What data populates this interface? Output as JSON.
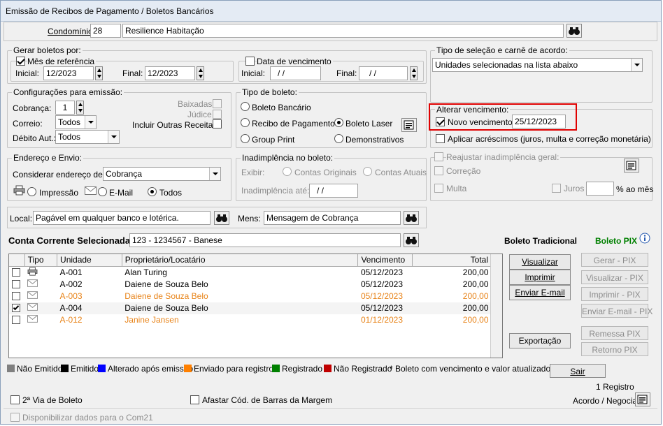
{
  "window": {
    "title": "Emissão de Recibos de Pagamento / Boletos Bancários"
  },
  "condominio": {
    "label": "Condomínio:",
    "code": "28",
    "name": "Resilience Habitação"
  },
  "gerar": {
    "legend": "Gerar boletos por:",
    "mes_label": "Mês de referência",
    "mes_checked": true,
    "inicial_label": "Inicial:",
    "inicial": "12/2023",
    "final_label": "Final:",
    "final": "12/2023",
    "data_label": "Data de vencimento",
    "data_checked": false,
    "d_inicial": "/ /",
    "d_final": "/ /"
  },
  "tipo_selecao": {
    "legend": "Tipo de seleção e carnê de acordo:",
    "value": "Unidades selecionadas na lista abaixo"
  },
  "config": {
    "legend": "Configurações para emissão:",
    "cobranca_label": "Cobrança:",
    "cobranca": "1",
    "correio_label": "Correio:",
    "correio": "Todos",
    "debito_label": "Débito Aut.:",
    "debito": "Todos",
    "baixadas": "Baixadas",
    "judice": "Júdice",
    "outras": "Incluir Outras Receitas"
  },
  "tipo_boleto": {
    "legend": "Tipo de boleto:",
    "opt1": "Boleto Bancário",
    "opt2": "Recibo de Pagamento",
    "opt3": "Boleto Laser",
    "opt4": "Group Print",
    "opt5": "Demonstrativos",
    "selected": "Boleto Laser"
  },
  "alterar": {
    "legend": "Alterar vencimento:",
    "novo_label": "Novo vencimento",
    "novo_checked": true,
    "novo_date": "25/12/2023",
    "acrescimos": "Aplicar acréscimos (juros, multa e correção monetária)"
  },
  "endereco": {
    "legend": "Endereço e Envio:",
    "considerar": "Considerar endereço de:",
    "value": "Cobrança",
    "impressao": "Impressão",
    "email": "E-Mail",
    "todos": "Todos"
  },
  "inad": {
    "legend": "Inadimplência no boleto:",
    "exibir": "Exibir:",
    "originais": "Contas Originais",
    "atuais": "Contas Atuais",
    "ate": "Inadimplência até:",
    "ate_value": "/ /"
  },
  "reajustar": {
    "legend": "Reajustar inadimplência geral:",
    "correcao": "Correção",
    "multa": "Multa",
    "juros": "Juros",
    "ao_mes": "% ao mês"
  },
  "local": {
    "label": "Local:",
    "value": "Pagável em qualquer banco e lotérica.",
    "mens_label": "Mens:",
    "mens_value": "Mensagem de Cobrança"
  },
  "conta": {
    "label": "Conta Corrente Selecionada:",
    "value": "123 - 1234567 - Banese"
  },
  "boleto_trad": "Boleto Tradicional",
  "boleto_pix": "Boleto PIX",
  "table": {
    "headers": [
      "Tipo",
      "Unidade",
      "Proprietário/Locatário",
      "Vencimento",
      "Total"
    ],
    "rows": [
      {
        "checked": false,
        "icon": "printer-icon",
        "unidade": "A-001",
        "nome": "Alan Turing",
        "venc": "05/12/2023",
        "total": "200,00",
        "color": "#000000"
      },
      {
        "checked": false,
        "icon": "envelope-icon",
        "unidade": "A-002",
        "nome": "Daiene de Souza Belo",
        "venc": "05/12/2023",
        "total": "200,00",
        "color": "#000000"
      },
      {
        "checked": false,
        "icon": "envelope-icon",
        "unidade": "A-003",
        "nome": "Daiene de Souza Belo",
        "venc": "05/12/2023",
        "total": "200,00",
        "color": "#e8841a"
      },
      {
        "checked": true,
        "icon": "envelope-icon",
        "unidade": "A-004",
        "nome": "Daiene de Souza Belo",
        "venc": "05/12/2023",
        "total": "200,00",
        "color": "#000000"
      },
      {
        "checked": false,
        "icon": "envelope-icon",
        "unidade": "A-012",
        "nome": "Janine Jansen",
        "venc": "01/12/2023",
        "total": "200,00",
        "color": "#e8841a"
      }
    ]
  },
  "buttons": {
    "visualizar": "Visualizar",
    "imprimir": "Imprimir",
    "enviar": "Enviar E-mail",
    "exportacao": "Exportação",
    "gerar_pix": "Gerar - PIX",
    "visualizar_pix": "Visualizar - PIX",
    "imprimir_pix": "Imprimir - PIX",
    "enviar_pix": "Enviar E-mail - PIX",
    "remessa_pix": "Remessa PIX",
    "retorno_pix": "Retorno PIX",
    "sair": "Sair"
  },
  "legend_items": [
    {
      "label": "Não Emitido",
      "color": "#808080"
    },
    {
      "label": "Emitido",
      "color": "#000000"
    },
    {
      "label": "Alterado após emissão",
      "color": "#0000ff"
    },
    {
      "label": "Enviado para registro",
      "color": "#ff8000"
    },
    {
      "label": "Registrado",
      "color": "#008000"
    },
    {
      "label": "Não Registrado",
      "color": "#c00000"
    }
  ],
  "note": "* Boleto com vencimento e valor atualizados.",
  "registros": "1 Registro",
  "segunda_via": "2ª Via de Boleto",
  "afastar": "Afastar Cód. de Barras da Margem",
  "acordo": "Acordo / Negociar",
  "disponibilizar": "Disponibilizar dados para o Com21",
  "colors": {
    "highlight": "#e00000",
    "pix_green": "#008000",
    "orange": "#e8841a"
  }
}
